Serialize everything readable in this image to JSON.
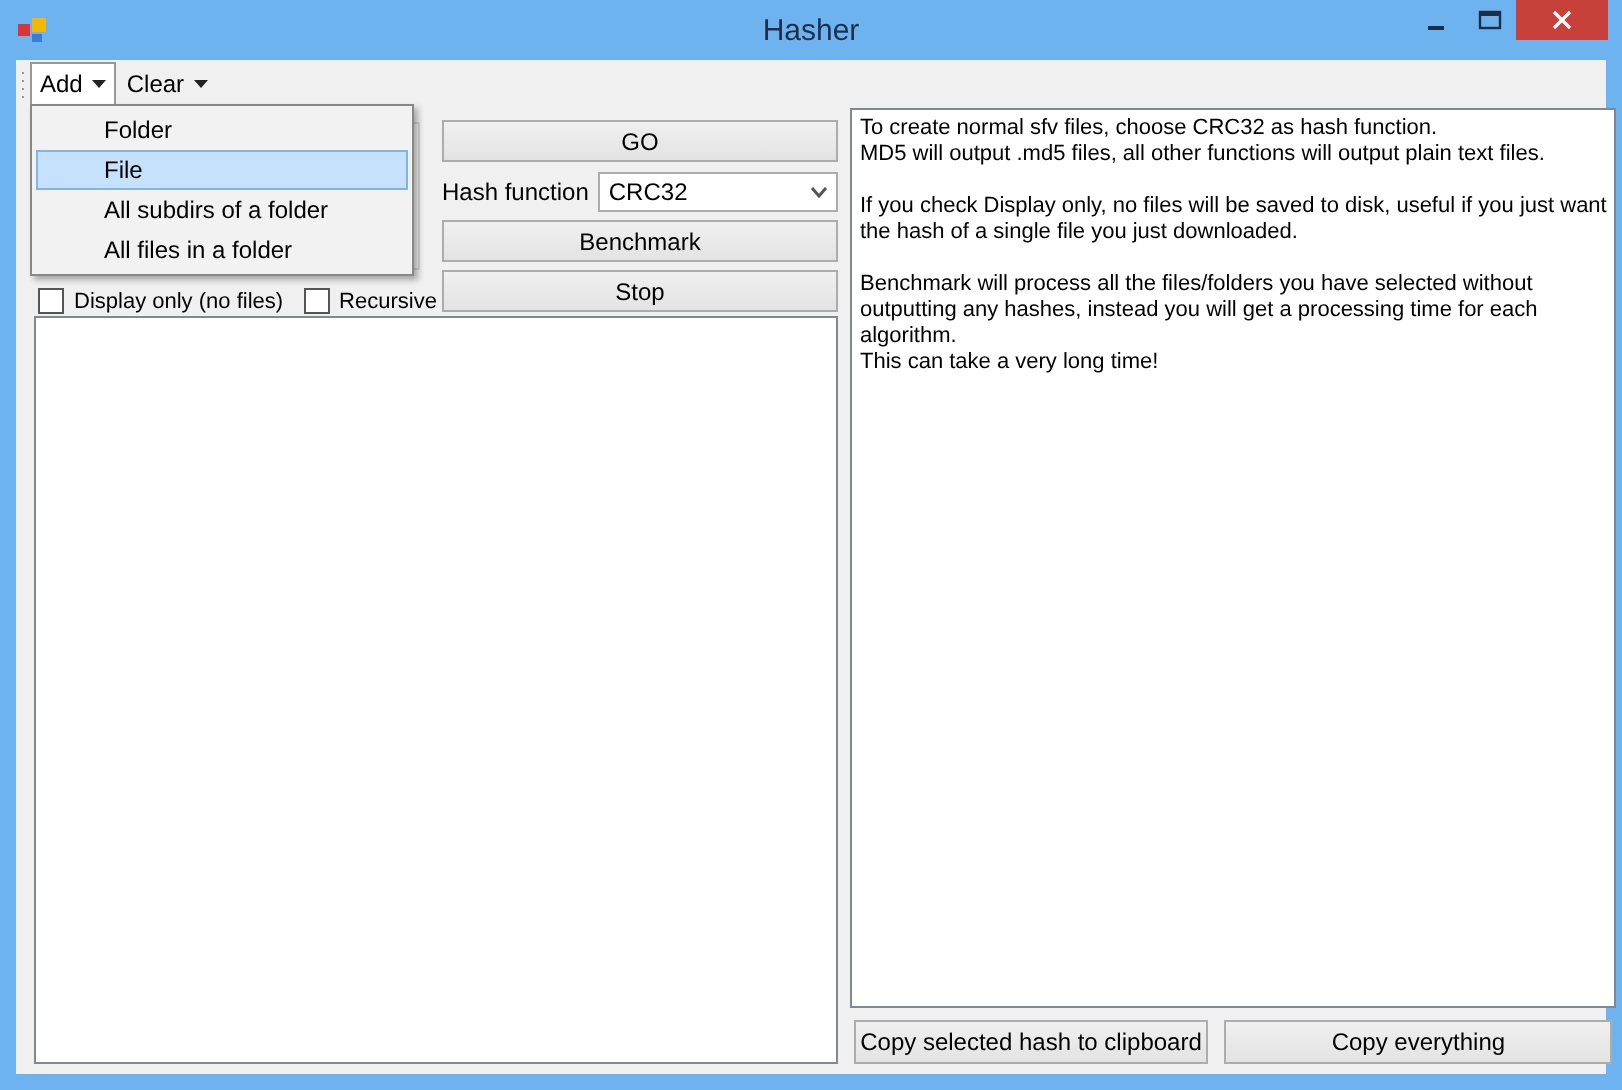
{
  "window": {
    "title": "Hasher"
  },
  "menu": [
    {
      "label": "Add",
      "expanded": true
    },
    {
      "label": "Clear",
      "expanded": false
    }
  ],
  "dropdown": [
    {
      "label": "Folder",
      "selected": false
    },
    {
      "label": "File",
      "selected": true
    },
    {
      "label": "All subdirs of a folder",
      "selected": false
    },
    {
      "label": "All files in a folder",
      "selected": false
    }
  ],
  "options": [
    {
      "label": "Display only (no files)",
      "checked": false
    },
    {
      "label": "Recursive",
      "checked": false
    }
  ],
  "go_button": "GO",
  "hash_function": {
    "label": "Hash function",
    "value": "CRC32"
  },
  "benchmark_button": "Benchmark",
  "stop_button": "Stop",
  "info_text": [
    [
      "To create normal sfv files, choose CRC32 as hash function.",
      "MD5 will output .md5 files, all other functions will output plain text files."
    ],
    [
      "If you check Display only, no files will be saved to disk, useful if you just want",
      "the hash of a single file you just downloaded."
    ],
    [
      "Benchmark will process all the files/folders you have selected without",
      "outputting any hashes, instead you will get a processing time for each",
      "algorithm.",
      "This can take a very long time!"
    ]
  ],
  "bottom_buttons": [
    "Copy selected hash to clipboard",
    "Copy everything"
  ]
}
